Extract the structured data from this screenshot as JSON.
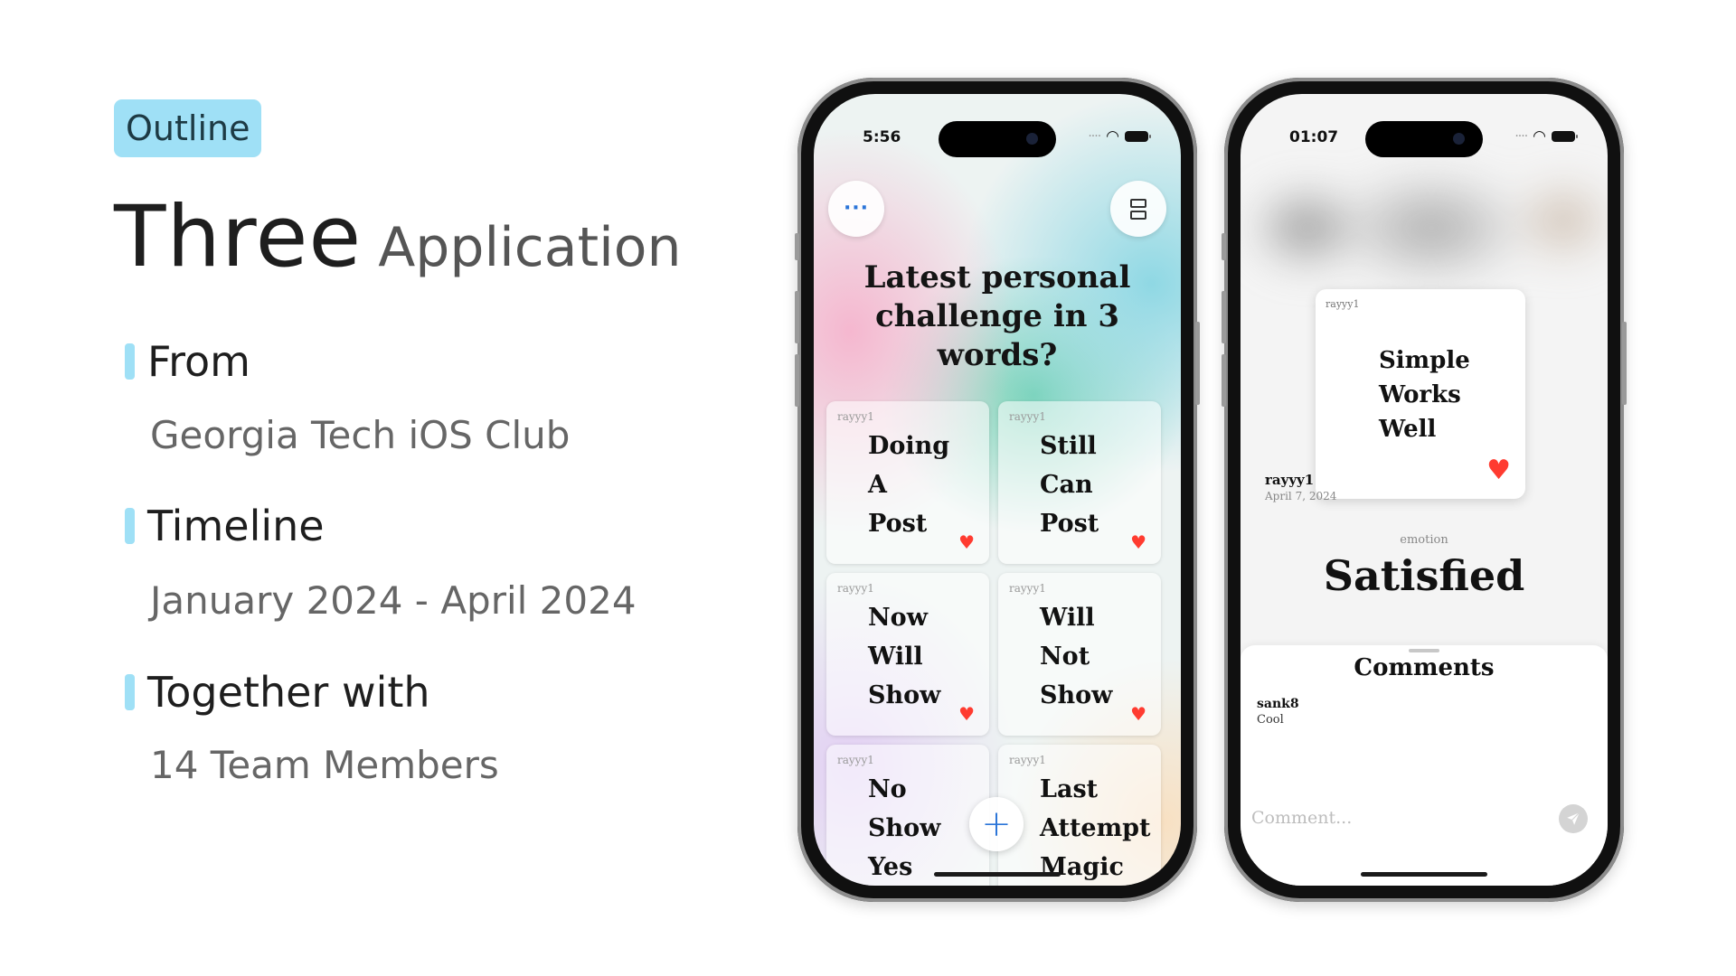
{
  "outline": {
    "badge": "Outline",
    "title_main": "Three",
    "title_sub": "Application",
    "sections": [
      {
        "heading": "From",
        "detail": "Georgia Tech iOS Club"
      },
      {
        "heading": "Timeline",
        "detail": "January 2024 - April 2024"
      },
      {
        "heading": "Together with",
        "detail": "14 Team Members"
      }
    ]
  },
  "phone1": {
    "time": "5:56",
    "more_label": "···",
    "question_lines": [
      "Latest personal",
      "challenge in 3",
      "words?"
    ],
    "posts": [
      {
        "user": "rayyy1",
        "words": [
          "Doing",
          "A",
          "Post"
        ]
      },
      {
        "user": "rayyy1",
        "words": [
          "Still",
          "Can",
          "Post"
        ]
      },
      {
        "user": "rayyy1",
        "words": [
          "Now",
          "Will",
          "Show"
        ]
      },
      {
        "user": "rayyy1",
        "words": [
          "Will",
          "Not",
          "Show"
        ]
      },
      {
        "user": "rayyy1",
        "words": [
          "No",
          "Show",
          "Yes"
        ]
      },
      {
        "user": "rayyy1",
        "words": [
          "Last",
          "Attempt",
          "Magic"
        ]
      }
    ],
    "add_label": "+"
  },
  "phone2": {
    "time": "01:07",
    "card": {
      "user": "rayyy1",
      "words": [
        "Simple",
        "Works",
        "Well"
      ]
    },
    "owner_name": "rayyy1",
    "owner_date": "April 7, 2024",
    "emotion_label": "emotion",
    "emotion": "Satisfied",
    "comments_title": "Comments",
    "comments": [
      {
        "user": "sank8",
        "text": "Cool"
      }
    ],
    "comment_placeholder": "Comment..."
  },
  "colors": {
    "accent": "#9fe0f6",
    "link_blue": "#2a74d8",
    "heart_red": "#ff3b30"
  }
}
